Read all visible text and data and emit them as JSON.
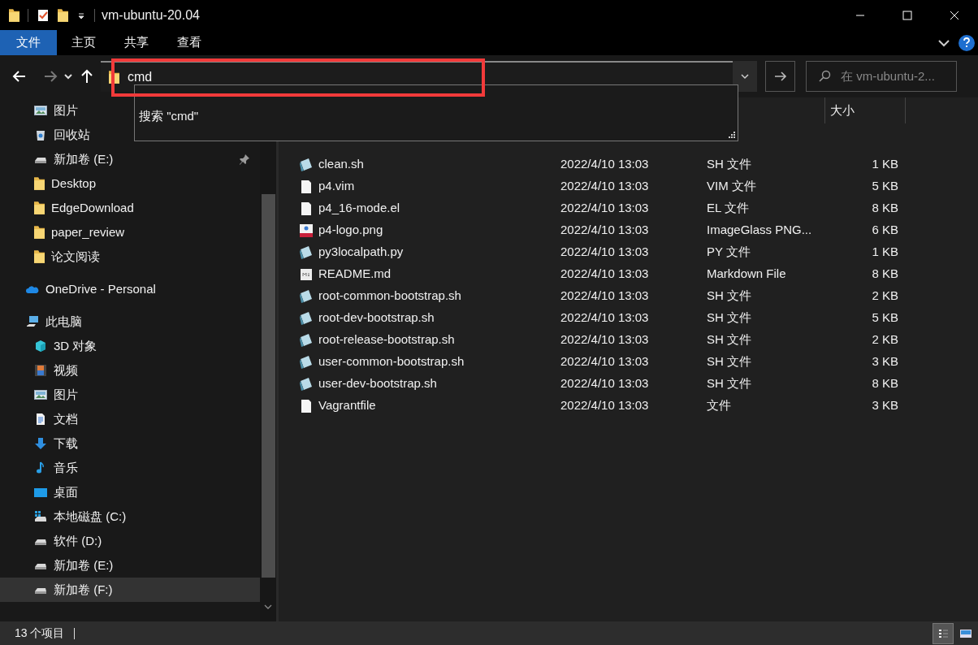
{
  "window": {
    "title": "vm-ubuntu-20.04"
  },
  "ribbon_tabs": [
    {
      "label": "文件",
      "kind": "file_menu"
    },
    {
      "label": "主页",
      "kind": "tab"
    },
    {
      "label": "共享",
      "kind": "tab"
    },
    {
      "label": "查看",
      "kind": "tab"
    }
  ],
  "navigation": {
    "back_disabled": false,
    "forward_disabled": true
  },
  "address_bar": {
    "value": "cmd"
  },
  "autocomplete": [
    "搜索 \"cmd\""
  ],
  "search": {
    "placeholder": "在 vm-ubuntu-2..."
  },
  "navigation_pane": [
    {
      "children": [
        {
          "label": "图片",
          "kind": "pictures",
          "pinned": false,
          "selected": false
        },
        {
          "label": "回收站",
          "kind": "recycle",
          "pinned": false,
          "selected": false
        },
        {
          "label": "新加卷 (E:)",
          "kind": "drive",
          "pinned": true,
          "selected": false
        },
        {
          "label": "Desktop",
          "kind": "folder",
          "pinned": false,
          "selected": false
        },
        {
          "label": "EdgeDownload",
          "kind": "folder",
          "pinned": false,
          "selected": false
        },
        {
          "label": "paper_review",
          "kind": "folder",
          "pinned": false,
          "selected": false
        },
        {
          "label": "论文阅读",
          "kind": "folder",
          "pinned": false,
          "selected": false
        }
      ]
    },
    {
      "label": "OneDrive - Personal",
      "kind": "cloud",
      "selected": false
    },
    {
      "label": "此电脑",
      "kind": "computer",
      "selected": false,
      "children": [
        {
          "label": "3D 对象",
          "kind": "cube",
          "pinned": false,
          "selected": false
        },
        {
          "label": "视频",
          "kind": "video",
          "pinned": false,
          "selected": false
        },
        {
          "label": "图片",
          "kind": "pictures",
          "pinned": false,
          "selected": false
        },
        {
          "label": "文档",
          "kind": "document",
          "pinned": false,
          "selected": false
        },
        {
          "label": "下载",
          "kind": "download",
          "pinned": false,
          "selected": false
        },
        {
          "label": "音乐",
          "kind": "music",
          "pinned": false,
          "selected": false
        },
        {
          "label": "桌面",
          "kind": "desktop",
          "pinned": false,
          "selected": false
        },
        {
          "label": "本地磁盘 (C:)",
          "kind": "system_drive",
          "pinned": false,
          "selected": false
        },
        {
          "label": "软件 (D:)",
          "kind": "drive",
          "pinned": false,
          "selected": false
        },
        {
          "label": "新加卷 (E:)",
          "kind": "drive",
          "pinned": false,
          "selected": false
        },
        {
          "label": "新加卷 (F:)",
          "kind": "drive",
          "pinned": false,
          "selected": true
        }
      ]
    }
  ],
  "table": {
    "columns": [
      {
        "label": "大小"
      }
    ],
    "rows": [
      {
        "kind": "script",
        "name": "clean.sh",
        "date": "2022/4/10 13:03",
        "type": "SH 文件",
        "size": "1 KB"
      },
      {
        "kind": "blank",
        "name": "p4.vim",
        "date": "2022/4/10 13:03",
        "type": "VIM 文件",
        "size": "5 KB"
      },
      {
        "kind": "blank",
        "name": "p4_16-mode.el",
        "date": "2022/4/10 13:03",
        "type": "EL 文件",
        "size": "8 KB"
      },
      {
        "kind": "png",
        "name": "p4-logo.png",
        "date": "2022/4/10 13:03",
        "type": "ImageGlass PNG...",
        "size": "6 KB"
      },
      {
        "kind": "script",
        "name": "py3localpath.py",
        "date": "2022/4/10 13:03",
        "type": "PY 文件",
        "size": "1 KB"
      },
      {
        "kind": "markdown",
        "name": "README.md",
        "date": "2022/4/10 13:03",
        "type": "Markdown File",
        "size": "8 KB"
      },
      {
        "kind": "script",
        "name": "root-common-bootstrap.sh",
        "date": "2022/4/10 13:03",
        "type": "SH 文件",
        "size": "2 KB"
      },
      {
        "kind": "script",
        "name": "root-dev-bootstrap.sh",
        "date": "2022/4/10 13:03",
        "type": "SH 文件",
        "size": "5 KB"
      },
      {
        "kind": "script",
        "name": "root-release-bootstrap.sh",
        "date": "2022/4/10 13:03",
        "type": "SH 文件",
        "size": "2 KB"
      },
      {
        "kind": "script",
        "name": "user-common-bootstrap.sh",
        "date": "2022/4/10 13:03",
        "type": "SH 文件",
        "size": "3 KB"
      },
      {
        "kind": "script",
        "name": "user-dev-bootstrap.sh",
        "date": "2022/4/10 13:03",
        "type": "SH 文件",
        "size": "8 KB"
      },
      {
        "kind": "blank",
        "name": "Vagrantfile",
        "date": "2022/4/10 13:03",
        "type": "文件",
        "size": "3 KB"
      }
    ]
  },
  "status_bar": {
    "count": "13 个项目"
  },
  "view_buttons": [
    {
      "kind": "details",
      "selected": true
    },
    {
      "kind": "thumbnails",
      "selected": false
    }
  ]
}
